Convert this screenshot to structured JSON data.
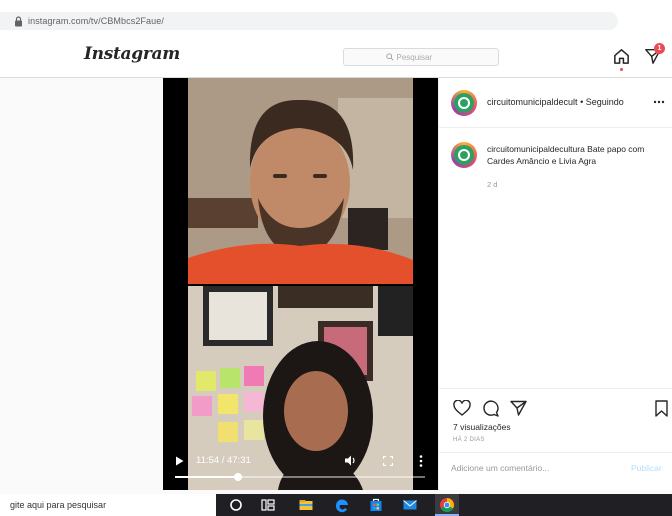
{
  "browser": {
    "url": "instagram.com/tv/CBMbcs2Faue/"
  },
  "header": {
    "logo": "Instagram",
    "search_placeholder": "Pesquisar",
    "notifications_count": "1"
  },
  "video": {
    "time": "11:54 / 47:31",
    "progress": 0.25
  },
  "post": {
    "header_user": "circuitomunicipaldecult",
    "header_follow": "• Seguindo",
    "caption_user": "circuitomunicipaldecultura",
    "caption_text": "Bate papo com Cardes Amâncio e Livia Agra",
    "caption_age": "2 d",
    "views": "7 visualizações",
    "date": "HÁ 2 DIAS",
    "comment_placeholder": "Adicione um comentário...",
    "publish_label": "Publicar"
  },
  "taskbar": {
    "search_placeholder": "gite aqui para pesquisar"
  },
  "colors": {
    "accent_red": "#ed4956",
    "publish_disabled": "#b2dffc",
    "avatar_green": "#2e9f62"
  }
}
